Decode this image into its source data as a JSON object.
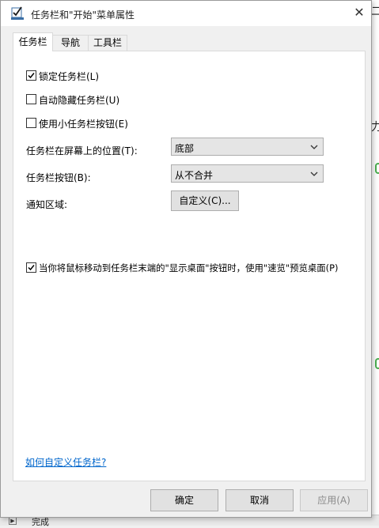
{
  "background": {
    "chars": [
      "二",
      "力",
      "("
    ],
    "status_text": "完成",
    "status_icon": "play-icon"
  },
  "dialog": {
    "title": "任务栏和\"开始\"菜单属性",
    "title_icon": "taskbar-checkbox-icon",
    "close_label": "✕"
  },
  "tabs": [
    {
      "label": "任务栏",
      "active": true
    },
    {
      "label": "导航",
      "active": false
    },
    {
      "label": "工具栏",
      "active": false
    }
  ],
  "options": {
    "lock_taskbar": {
      "label": "锁定任务栏(L)",
      "checked": true
    },
    "auto_hide": {
      "label": "自动隐藏任务栏(U)",
      "checked": false
    },
    "small_buttons": {
      "label": "使用小任务栏按钮(E)",
      "checked": false
    },
    "peek": {
      "label": "当你将鼠标移动到任务栏末端的\"显示桌面\"按钮时，使用\"速览\"预览桌面(P)",
      "checked": true
    }
  },
  "location": {
    "label": "任务栏在屏幕上的位置(T):",
    "value": "底部"
  },
  "buttons_setting": {
    "label": "任务栏按钮(B):",
    "value": "从不合并"
  },
  "notification": {
    "label": "通知区域:",
    "button": "自定义(C)..."
  },
  "help_link": "如何自定义任务栏?",
  "footer": {
    "ok": "确定",
    "cancel": "取消",
    "apply": "应用(A)"
  }
}
